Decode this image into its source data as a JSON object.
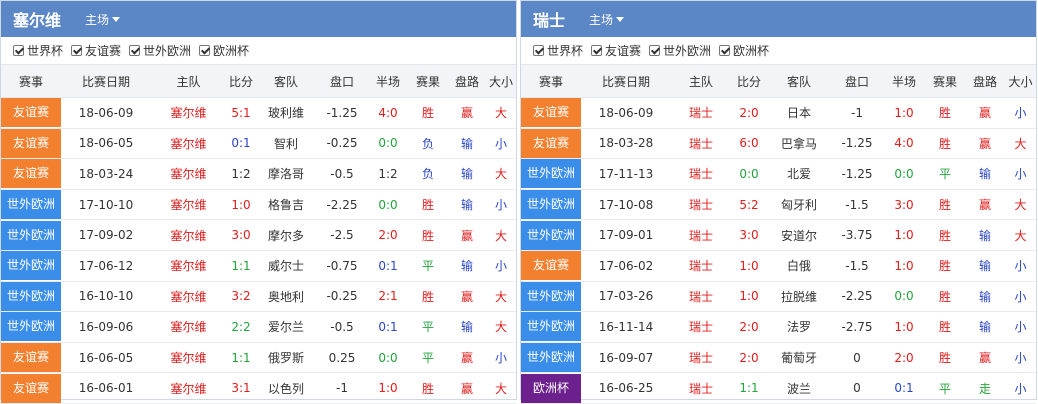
{
  "colors": {
    "header_bg": "#5b87c6",
    "friendly": "#f2802f",
    "wc_qual": "#3a8eea",
    "euro": "#6b208e",
    "red": "#e31c1c",
    "green": "#23a33c",
    "blue": "#2a46c9"
  },
  "panels": [
    {
      "team": "塞尔维",
      "venue": "主场",
      "filters": [
        "世界杯",
        "友谊赛",
        "世外欧洲",
        "欧洲杯"
      ],
      "headers": [
        "赛事",
        "比赛日期",
        "主队",
        "比分",
        "客队",
        "盘口",
        "半场",
        "赛果",
        "盘路",
        "大小"
      ],
      "rows": [
        {
          "event": "友谊赛",
          "type": "friendly",
          "date": "18-06-09",
          "home": "塞尔维",
          "score": "5:1",
          "scolor": "red",
          "away": "玻利维",
          "line": "-1.25",
          "half": "4:0",
          "hcolor": "red",
          "result": "胜",
          "rcolor": "red",
          "pan": "赢",
          "pcolor": "red",
          "size": "大",
          "zcolor": "red"
        },
        {
          "event": "友谊赛",
          "type": "friendly",
          "date": "18-06-05",
          "home": "塞尔维",
          "score": "0:1",
          "scolor": "blue",
          "away": "智利",
          "line": "-0.25",
          "half": "0:0",
          "hcolor": "green",
          "result": "负",
          "rcolor": "blue",
          "pan": "输",
          "pcolor": "blue",
          "size": "小",
          "zcolor": "blue"
        },
        {
          "event": "友谊赛",
          "type": "friendly",
          "date": "18-03-24",
          "home": "塞尔维",
          "score": "1:2",
          "scolor": "plain",
          "away": "摩洛哥",
          "line": "-0.5",
          "half": "1:2",
          "hcolor": "plain",
          "result": "负",
          "rcolor": "blue",
          "pan": "输",
          "pcolor": "blue",
          "size": "大",
          "zcolor": "red"
        },
        {
          "event": "世外欧洲",
          "type": "wc",
          "date": "17-10-10",
          "home": "塞尔维",
          "score": "1:0",
          "scolor": "red",
          "away": "格鲁吉",
          "line": "-2.25",
          "half": "0:0",
          "hcolor": "green",
          "result": "胜",
          "rcolor": "red",
          "pan": "输",
          "pcolor": "blue",
          "size": "小",
          "zcolor": "blue"
        },
        {
          "event": "世外欧洲",
          "type": "wc",
          "date": "17-09-02",
          "home": "塞尔维",
          "score": "3:0",
          "scolor": "red",
          "away": "摩尔多",
          "line": "-2.5",
          "half": "2:0",
          "hcolor": "red",
          "result": "胜",
          "rcolor": "red",
          "pan": "赢",
          "pcolor": "red",
          "size": "大",
          "zcolor": "red"
        },
        {
          "event": "世外欧洲",
          "type": "wc",
          "date": "17-06-12",
          "home": "塞尔维",
          "score": "1:1",
          "scolor": "green",
          "away": "威尔士",
          "line": "-0.75",
          "half": "0:1",
          "hcolor": "blue",
          "result": "平",
          "rcolor": "green",
          "pan": "输",
          "pcolor": "blue",
          "size": "小",
          "zcolor": "blue"
        },
        {
          "event": "世外欧洲",
          "type": "wc",
          "date": "16-10-10",
          "home": "塞尔维",
          "score": "3:2",
          "scolor": "red",
          "away": "奥地利",
          "line": "-0.25",
          "half": "2:1",
          "hcolor": "red",
          "result": "胜",
          "rcolor": "red",
          "pan": "赢",
          "pcolor": "red",
          "size": "大",
          "zcolor": "red"
        },
        {
          "event": "世外欧洲",
          "type": "wc",
          "date": "16-09-06",
          "home": "塞尔维",
          "score": "2:2",
          "scolor": "green",
          "away": "爱尔兰",
          "line": "-0.5",
          "half": "0:1",
          "hcolor": "blue",
          "result": "平",
          "rcolor": "green",
          "pan": "输",
          "pcolor": "blue",
          "size": "大",
          "zcolor": "red"
        },
        {
          "event": "友谊赛",
          "type": "friendly",
          "date": "16-06-05",
          "home": "塞尔维",
          "score": "1:1",
          "scolor": "green",
          "away": "俄罗斯",
          "line": "0.25",
          "half": "0:0",
          "hcolor": "green",
          "result": "平",
          "rcolor": "green",
          "pan": "赢",
          "pcolor": "red",
          "size": "小",
          "zcolor": "blue"
        },
        {
          "event": "友谊赛",
          "type": "friendly",
          "date": "16-06-01",
          "home": "塞尔维",
          "score": "3:1",
          "scolor": "red",
          "away": "以色列",
          "line": "-1",
          "half": "1:0",
          "hcolor": "red",
          "result": "胜",
          "rcolor": "red",
          "pan": "赢",
          "pcolor": "red",
          "size": "大",
          "zcolor": "red"
        }
      ]
    },
    {
      "team": "瑞士",
      "venue": "主场",
      "filters": [
        "世界杯",
        "友谊赛",
        "世外欧洲",
        "欧洲杯"
      ],
      "headers": [
        "赛事",
        "比赛日期",
        "主队",
        "比分",
        "客队",
        "盘口",
        "半场",
        "赛果",
        "盘路",
        "大小"
      ],
      "rows": [
        {
          "event": "友谊赛",
          "type": "friendly",
          "date": "18-06-09",
          "home": "瑞士",
          "score": "2:0",
          "scolor": "red",
          "away": "日本",
          "line": "-1",
          "half": "1:0",
          "hcolor": "red",
          "result": "胜",
          "rcolor": "red",
          "pan": "赢",
          "pcolor": "red",
          "size": "小",
          "zcolor": "blue"
        },
        {
          "event": "友谊赛",
          "type": "friendly",
          "date": "18-03-28",
          "home": "瑞士",
          "score": "6:0",
          "scolor": "red",
          "away": "巴拿马",
          "line": "-1.25",
          "half": "4:0",
          "hcolor": "red",
          "result": "胜",
          "rcolor": "red",
          "pan": "赢",
          "pcolor": "red",
          "size": "大",
          "zcolor": "red"
        },
        {
          "event": "世外欧洲",
          "type": "wc",
          "date": "17-11-13",
          "home": "瑞士",
          "score": "0:0",
          "scolor": "green",
          "away": "北爱",
          "line": "-1.25",
          "half": "0:0",
          "hcolor": "green",
          "result": "平",
          "rcolor": "green",
          "pan": "输",
          "pcolor": "blue",
          "size": "小",
          "zcolor": "blue"
        },
        {
          "event": "世外欧洲",
          "type": "wc",
          "date": "17-10-08",
          "home": "瑞士",
          "score": "5:2",
          "scolor": "red",
          "away": "匈牙利",
          "line": "-1.5",
          "half": "3:0",
          "hcolor": "red",
          "result": "胜",
          "rcolor": "red",
          "pan": "赢",
          "pcolor": "red",
          "size": "大",
          "zcolor": "red"
        },
        {
          "event": "世外欧洲",
          "type": "wc",
          "date": "17-09-01",
          "home": "瑞士",
          "score": "3:0",
          "scolor": "red",
          "away": "安道尔",
          "line": "-3.75",
          "half": "1:0",
          "hcolor": "red",
          "result": "胜",
          "rcolor": "red",
          "pan": "输",
          "pcolor": "blue",
          "size": "大",
          "zcolor": "red"
        },
        {
          "event": "友谊赛",
          "type": "friendly",
          "date": "17-06-02",
          "home": "瑞士",
          "score": "1:0",
          "scolor": "red",
          "away": "白俄",
          "line": "-1.5",
          "half": "1:0",
          "hcolor": "red",
          "result": "胜",
          "rcolor": "red",
          "pan": "输",
          "pcolor": "blue",
          "size": "小",
          "zcolor": "blue"
        },
        {
          "event": "世外欧洲",
          "type": "wc",
          "date": "17-03-26",
          "home": "瑞士",
          "score": "1:0",
          "scolor": "red",
          "away": "拉脱维",
          "line": "-2.25",
          "half": "0:0",
          "hcolor": "green",
          "result": "胜",
          "rcolor": "red",
          "pan": "输",
          "pcolor": "blue",
          "size": "小",
          "zcolor": "blue"
        },
        {
          "event": "世外欧洲",
          "type": "wc",
          "date": "16-11-14",
          "home": "瑞士",
          "score": "2:0",
          "scolor": "red",
          "away": "法罗",
          "line": "-2.75",
          "half": "1:0",
          "hcolor": "red",
          "result": "胜",
          "rcolor": "red",
          "pan": "输",
          "pcolor": "blue",
          "size": "小",
          "zcolor": "blue"
        },
        {
          "event": "世外欧洲",
          "type": "wc",
          "date": "16-09-07",
          "home": "瑞士",
          "score": "2:0",
          "scolor": "red",
          "away": "葡萄牙",
          "line": "0",
          "half": "2:0",
          "hcolor": "red",
          "result": "胜",
          "rcolor": "red",
          "pan": "赢",
          "pcolor": "red",
          "size": "小",
          "zcolor": "blue"
        },
        {
          "event": "欧洲杯",
          "type": "euro",
          "date": "16-06-25",
          "home": "瑞士",
          "score": "1:1",
          "scolor": "green",
          "away": "波兰",
          "line": "0",
          "half": "0:1",
          "hcolor": "blue",
          "result": "平",
          "rcolor": "green",
          "pan": "走",
          "pcolor": "green",
          "size": "小",
          "zcolor": "blue"
        }
      ]
    }
  ]
}
